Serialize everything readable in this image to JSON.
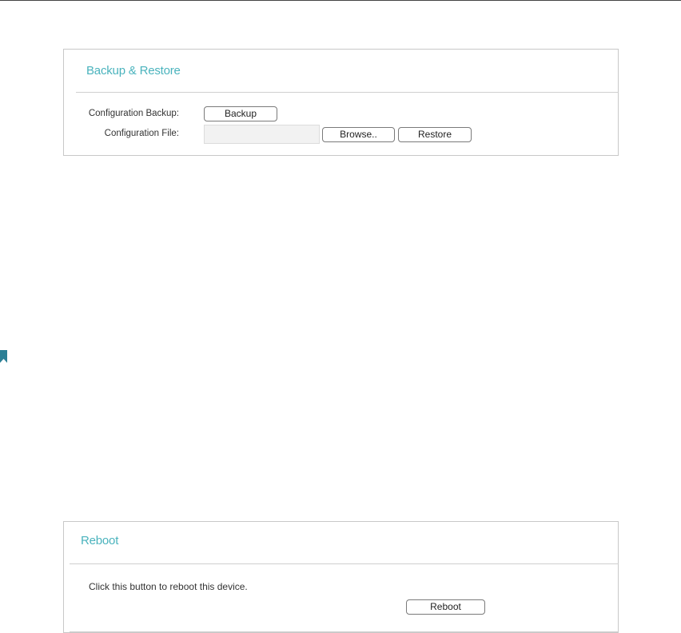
{
  "backup_restore": {
    "title": "Backup & Restore",
    "config_backup_label": "Configuration Backup:",
    "backup_button": "Backup",
    "config_file_label": "Configuration File:",
    "browse_button": "Browse..",
    "restore_button": "Restore"
  },
  "reboot": {
    "title": "Reboot",
    "description": "Click this button to reboot this device.",
    "reboot_button": "Reboot"
  },
  "icons": {
    "side_marker": "bookmark-icon"
  },
  "colors": {
    "accent": "#4ab3bd",
    "bookmark": "#2a7f95"
  }
}
